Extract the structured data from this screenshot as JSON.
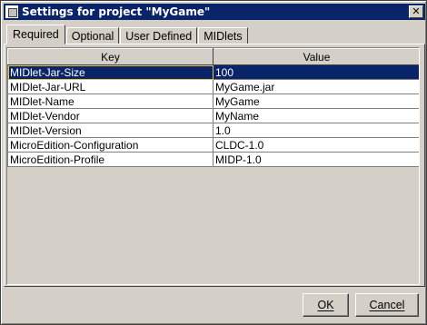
{
  "window": {
    "title": "Settings for project \"MyGame\"",
    "close_glyph": "✕"
  },
  "tabs": [
    {
      "label": "Required",
      "active": true
    },
    {
      "label": "Optional",
      "active": false
    },
    {
      "label": "User Defined",
      "active": false
    },
    {
      "label": "MIDlets",
      "active": false
    }
  ],
  "table": {
    "columns": [
      "Key",
      "Value"
    ],
    "rows": [
      {
        "key": "MIDlet-Jar-Size",
        "value": "100",
        "selected": true
      },
      {
        "key": "MIDlet-Jar-URL",
        "value": "MyGame.jar",
        "selected": false
      },
      {
        "key": "MIDlet-Name",
        "value": "MyGame",
        "selected": false
      },
      {
        "key": "MIDlet-Vendor",
        "value": "MyName",
        "selected": false
      },
      {
        "key": "MIDlet-Version",
        "value": "1.0",
        "selected": false
      },
      {
        "key": "MicroEdition-Configuration",
        "value": "CLDC-1.0",
        "selected": false
      },
      {
        "key": "MicroEdition-Profile",
        "value": "MIDP-1.0",
        "selected": false
      }
    ]
  },
  "buttons": {
    "ok": "OK",
    "cancel": "Cancel"
  },
  "colors": {
    "titlebar": "#0a246a",
    "selection": "#0a246a",
    "face": "#d4d0c8"
  }
}
